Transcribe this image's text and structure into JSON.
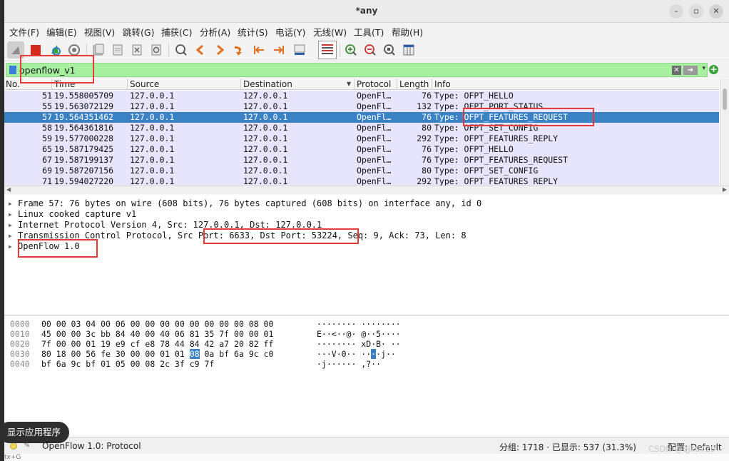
{
  "window": {
    "title": "*any"
  },
  "menu": [
    "文件(F)",
    "编辑(E)",
    "视图(V)",
    "跳转(G)",
    "捕获(C)",
    "分析(A)",
    "统计(S)",
    "电话(Y)",
    "无线(W)",
    "工具(T)",
    "帮助(H)"
  ],
  "filter": {
    "value": "openflow_v1"
  },
  "columns": {
    "no": "No.",
    "time": "Time",
    "source": "Source",
    "destination": "Destination",
    "protocol": "Protocol",
    "length": "Length",
    "info": "Info"
  },
  "packets": [
    {
      "no": "51",
      "time": "19.558005709",
      "src": "127.0.0.1",
      "dst": "127.0.0.1",
      "proto": "OpenFl…",
      "len": "76",
      "info": "Type: OFPT_HELLO"
    },
    {
      "no": "55",
      "time": "19.563072129",
      "src": "127.0.0.1",
      "dst": "127.0.0.1",
      "proto": "OpenFl…",
      "len": "132",
      "info": "Type: OFPT_PORT_STATUS"
    },
    {
      "no": "57",
      "time": "19.564351462",
      "src": "127.0.0.1",
      "dst": "127.0.0.1",
      "proto": "OpenFl…",
      "len": "76",
      "info": "Type: OFPT_FEATURES_REQUEST",
      "selected": true
    },
    {
      "no": "58",
      "time": "19.564361816",
      "src": "127.0.0.1",
      "dst": "127.0.0.1",
      "proto": "OpenFl…",
      "len": "80",
      "info": "Type: OFPT_SET_CONFIG"
    },
    {
      "no": "59",
      "time": "19.577000228",
      "src": "127.0.0.1",
      "dst": "127.0.0.1",
      "proto": "OpenFl…",
      "len": "292",
      "info": "Type: OFPT_FEATURES_REPLY"
    },
    {
      "no": "65",
      "time": "19.587179425",
      "src": "127.0.0.1",
      "dst": "127.0.0.1",
      "proto": "OpenFl…",
      "len": "76",
      "info": "Type: OFPT_HELLO"
    },
    {
      "no": "67",
      "time": "19.587199137",
      "src": "127.0.0.1",
      "dst": "127.0.0.1",
      "proto": "OpenFl…",
      "len": "76",
      "info": "Type: OFPT_FEATURES_REQUEST"
    },
    {
      "no": "69",
      "time": "19.587207156",
      "src": "127.0.0.1",
      "dst": "127.0.0.1",
      "proto": "OpenFl…",
      "len": "80",
      "info": "Type: OFPT_SET_CONFIG"
    },
    {
      "no": "71",
      "time": "19.594027220",
      "src": "127.0.0.1",
      "dst": "127.0.0.1",
      "proto": "OpenFl…",
      "len": "292",
      "info": "Type: OFPT_FEATURES_REPLY"
    }
  ],
  "details": [
    "Frame 57: 76 bytes on wire (608 bits), 76 bytes captured (608 bits) on interface any, id 0",
    "Linux cooked capture v1",
    "Internet Protocol Version 4, Src: 127.0.0.1, Dst: 127.0.0.1",
    "Transmission Control Protocol, Src Port: 6633, Dst Port: 53224, Seq: 9, Ack: 73, Len: 8",
    "OpenFlow 1.0"
  ],
  "bytes": [
    {
      "offset": "0000",
      "hex": "00 00 03 04 00 06 00 00  00 00 00 00 00 00 08 00",
      "ascii": "········ ········"
    },
    {
      "offset": "0010",
      "hex": "45 00 00 3c bb 84 40 00  40 06 81 35 7f 00 00 01",
      "ascii": "E··<··@· @··5····"
    },
    {
      "offset": "0020",
      "hex": "7f 00 00 01 19 e9 cf e8  78 44 84 42 a7 20 82 ff",
      "ascii": "········ xD·B· ··"
    },
    {
      "offset": "0030",
      "hex_pre": "80 18 00 56 fe 30 00 00  01 01 ",
      "hex_hl": "08",
      "hex_post": " 0a bf 6a 9c c0",
      "ascii_pre": "···V·0·· ··",
      "ascii_hl": "·",
      "ascii_post": "·j··"
    },
    {
      "offset": "0040",
      "hex": "bf 6a 9c bf 01 05 00 08  2c 3f c9 7f",
      "ascii": "·j······ ,?··"
    }
  ],
  "toast": "显示应用程序",
  "status": {
    "left": "OpenFlow 1.0: Protocol",
    "right": "分组: 1718 · 已显示: 537 (31.3%)",
    "profile": "配置: Default",
    "watermark": "CSDN @qjk0729",
    "bottom": "tx+G"
  },
  "colors": {
    "accent": "#3b82c4",
    "filter_bg": "#a6f0a0",
    "row_bg": "#e6e5fb",
    "annotation": "#e43a3a"
  }
}
